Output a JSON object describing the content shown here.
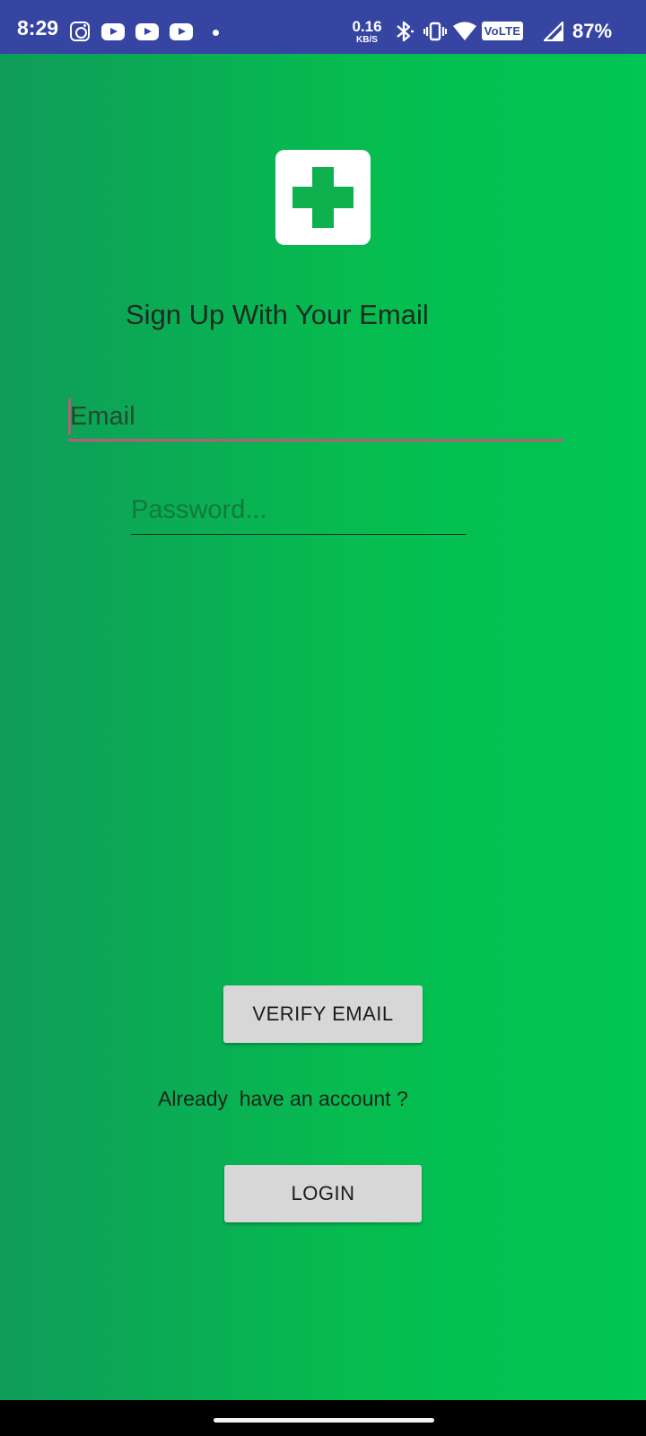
{
  "status_bar": {
    "time": "8:29",
    "notification_icons": [
      "instagram-icon",
      "youtube-icon",
      "youtube-icon",
      "youtube-icon",
      "more-dot-icon"
    ],
    "net_speed_value": "0.16",
    "net_speed_unit": "KB/S",
    "volte_label": "VoLTE",
    "battery": "87%",
    "background_color": "#3545a1"
  },
  "app": {
    "logo_icon": "medical-plus-icon",
    "accent_color": "#0fb14f",
    "title": "Sign Up With Your Email",
    "email": {
      "placeholder": "Email",
      "value": ""
    },
    "password": {
      "placeholder": "Password...",
      "value": ""
    },
    "verify_button_label": "VERIFY EMAIL",
    "have_account_text": "Already  have an account ?",
    "login_button_label": "LOGIN"
  },
  "nav_bar": {
    "handle": "gesture-handle"
  }
}
